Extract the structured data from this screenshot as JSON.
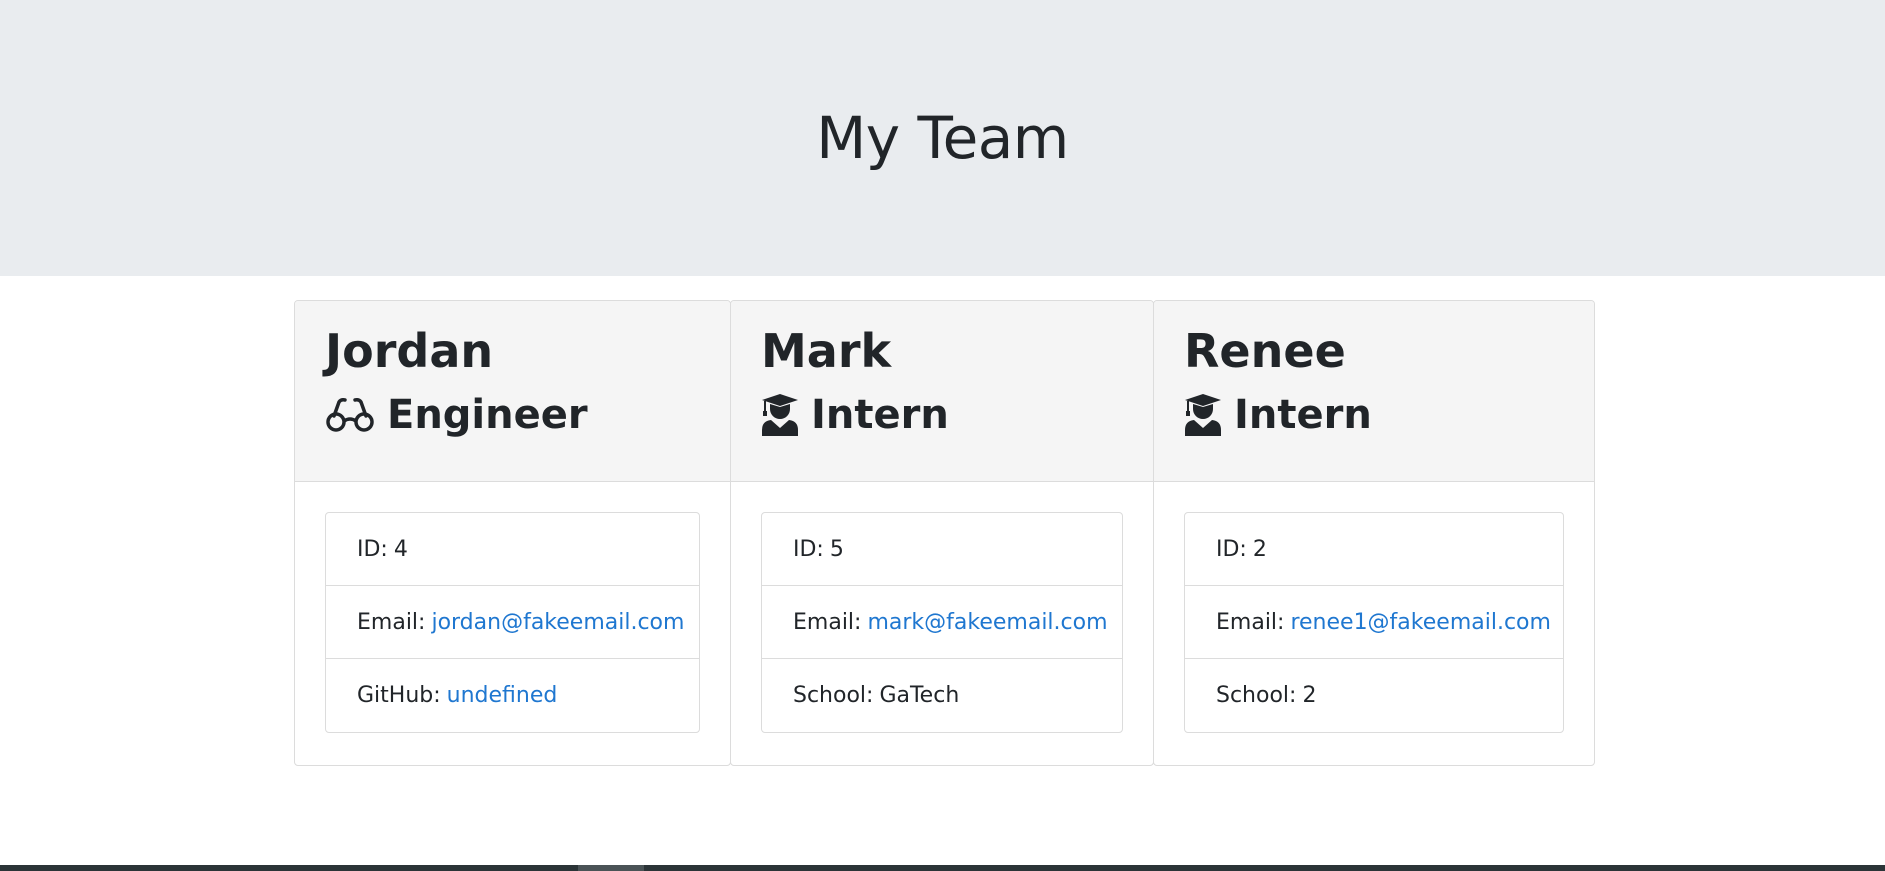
{
  "header": {
    "title": "My Team"
  },
  "cards": [
    {
      "name": "Jordan",
      "role": "Engineer",
      "role_icon": "glasses-icon",
      "id_label": "ID:",
      "id_value": "4",
      "email_label": "Email:",
      "email_value": "jordan@fakeemail.com",
      "extra_label": "GitHub:",
      "extra_value": "undefined"
    },
    {
      "name": "Mark",
      "role": "Intern",
      "role_icon": "user-graduate-icon",
      "id_label": "ID:",
      "id_value": "5",
      "email_label": "Email:",
      "email_value": "mark@fakeemail.com",
      "extra_label": "School:",
      "extra_value": "GaTech"
    },
    {
      "name": "Renee",
      "role": "Intern",
      "role_icon": "user-graduate-icon",
      "id_label": "ID:",
      "id_value": "2",
      "email_label": "Email:",
      "email_value": "renee1@fakeemail.com",
      "extra_label": "School:",
      "extra_value": "2"
    }
  ],
  "colors": {
    "header_bg": "#e9ecef",
    "card_header_bg": "#f5f5f5",
    "link": "#1f77d0",
    "text": "#212529"
  }
}
